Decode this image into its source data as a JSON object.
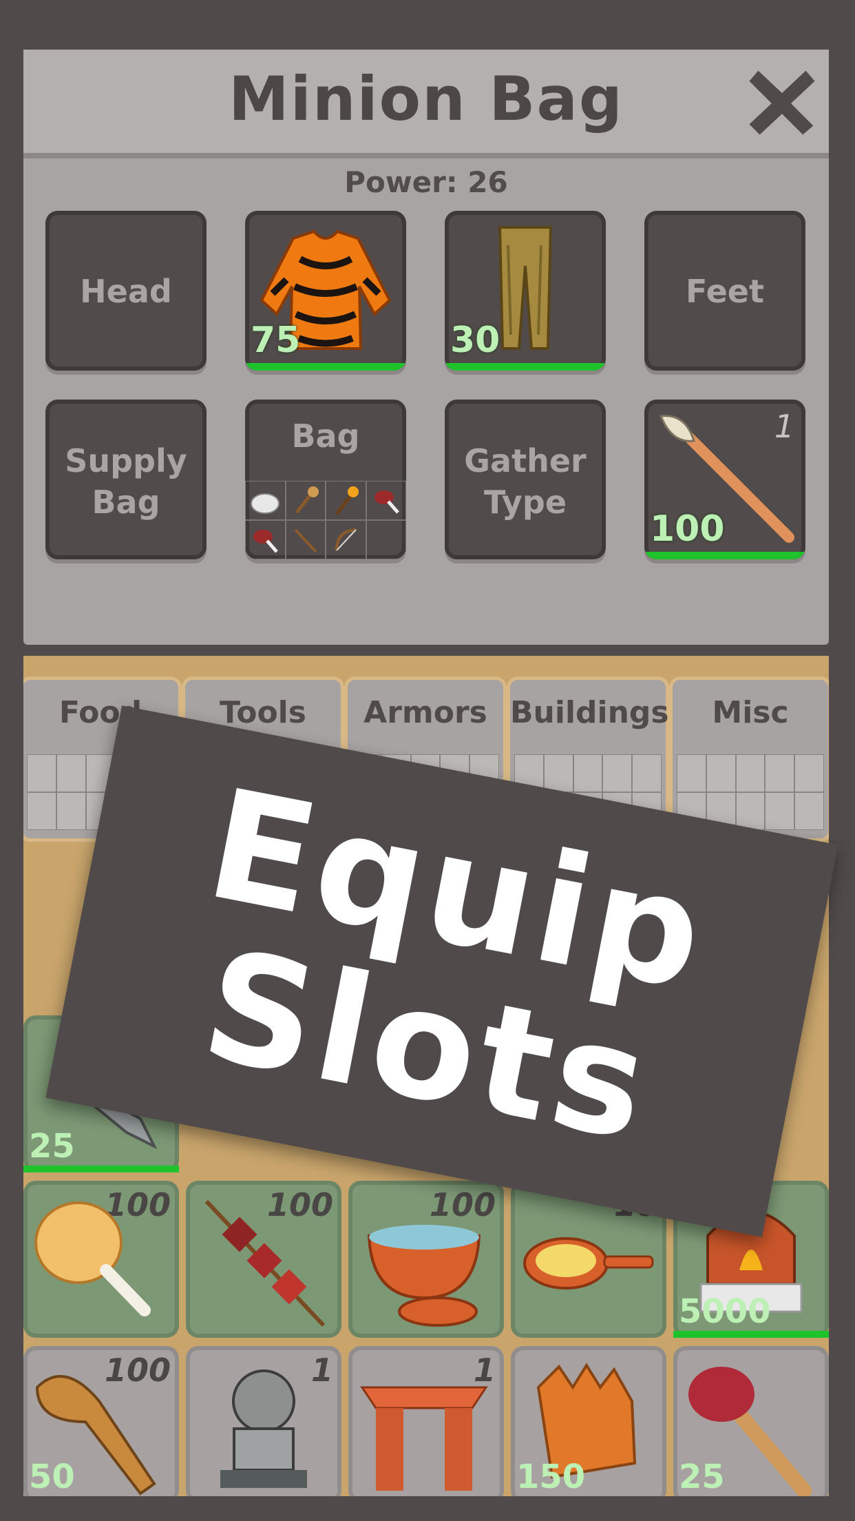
{
  "panel": {
    "title": "Minion Bag",
    "power_label": "Power: 26"
  },
  "slots": {
    "head": {
      "label": "Head"
    },
    "body": {
      "durability": "75",
      "fill_pct": 100
    },
    "legs": {
      "durability": "30",
      "fill_pct": 100
    },
    "feet": {
      "label": "Feet"
    },
    "supply_bag": {
      "label_line1": "Supply",
      "label_line2": "Bag"
    },
    "bag": {
      "label": "Bag"
    },
    "gather_type": {
      "label_line1": "Gather",
      "label_line2": "Type"
    },
    "weapon": {
      "count": "1",
      "durability": "100",
      "fill_pct": 100
    }
  },
  "tabs": [
    {
      "label": "Food"
    },
    {
      "label": "Tools"
    },
    {
      "label": "Armors"
    },
    {
      "label": "Buildings"
    },
    {
      "label": "Misc"
    }
  ],
  "inventory": {
    "row1": [
      {
        "num": "25",
        "fill_pct": 100
      }
    ],
    "row2": [
      {
        "count": "100"
      },
      {
        "count": "100"
      },
      {
        "count": "100"
      },
      {
        "count": "10"
      },
      {
        "num": "5000",
        "fill_pct": 100
      }
    ],
    "row3": [
      {
        "count": "100",
        "num": "50"
      },
      {
        "count": "1"
      },
      {
        "count": "1"
      },
      {
        "num": "150"
      },
      {
        "num": "25"
      }
    ]
  },
  "banner": {
    "line1": "Equip",
    "line2": "Slots"
  },
  "colors": {
    "background": "#514a4b",
    "durability_bar": "#1ec22a",
    "durability_text": "#bdf0b5"
  }
}
